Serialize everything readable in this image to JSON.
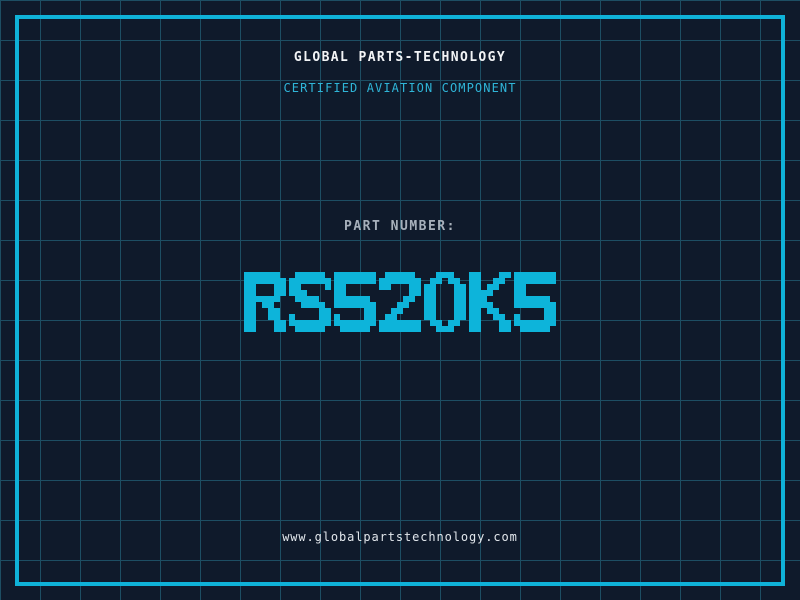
{
  "header": {
    "company_name": "GLOBAL PARTS-TECHNOLOGY",
    "certification": "CERTIFIED AVIATION COMPONENT"
  },
  "part": {
    "label": "PART NUMBER:",
    "number": "RS520K5"
  },
  "footer": {
    "website": "www.globalpartstechnology.com"
  },
  "colors": {
    "background": "#0f1a2b",
    "grid_line": "#1d4e63",
    "frame_cyan": "#0fb2d8",
    "part_number_cyan": "#0db4da",
    "subtitle_cyan": "#2fb5d8",
    "title_white": "#f2f4f6",
    "label_grey": "#a7b0bb",
    "url_grey": "#e2e7ec"
  }
}
